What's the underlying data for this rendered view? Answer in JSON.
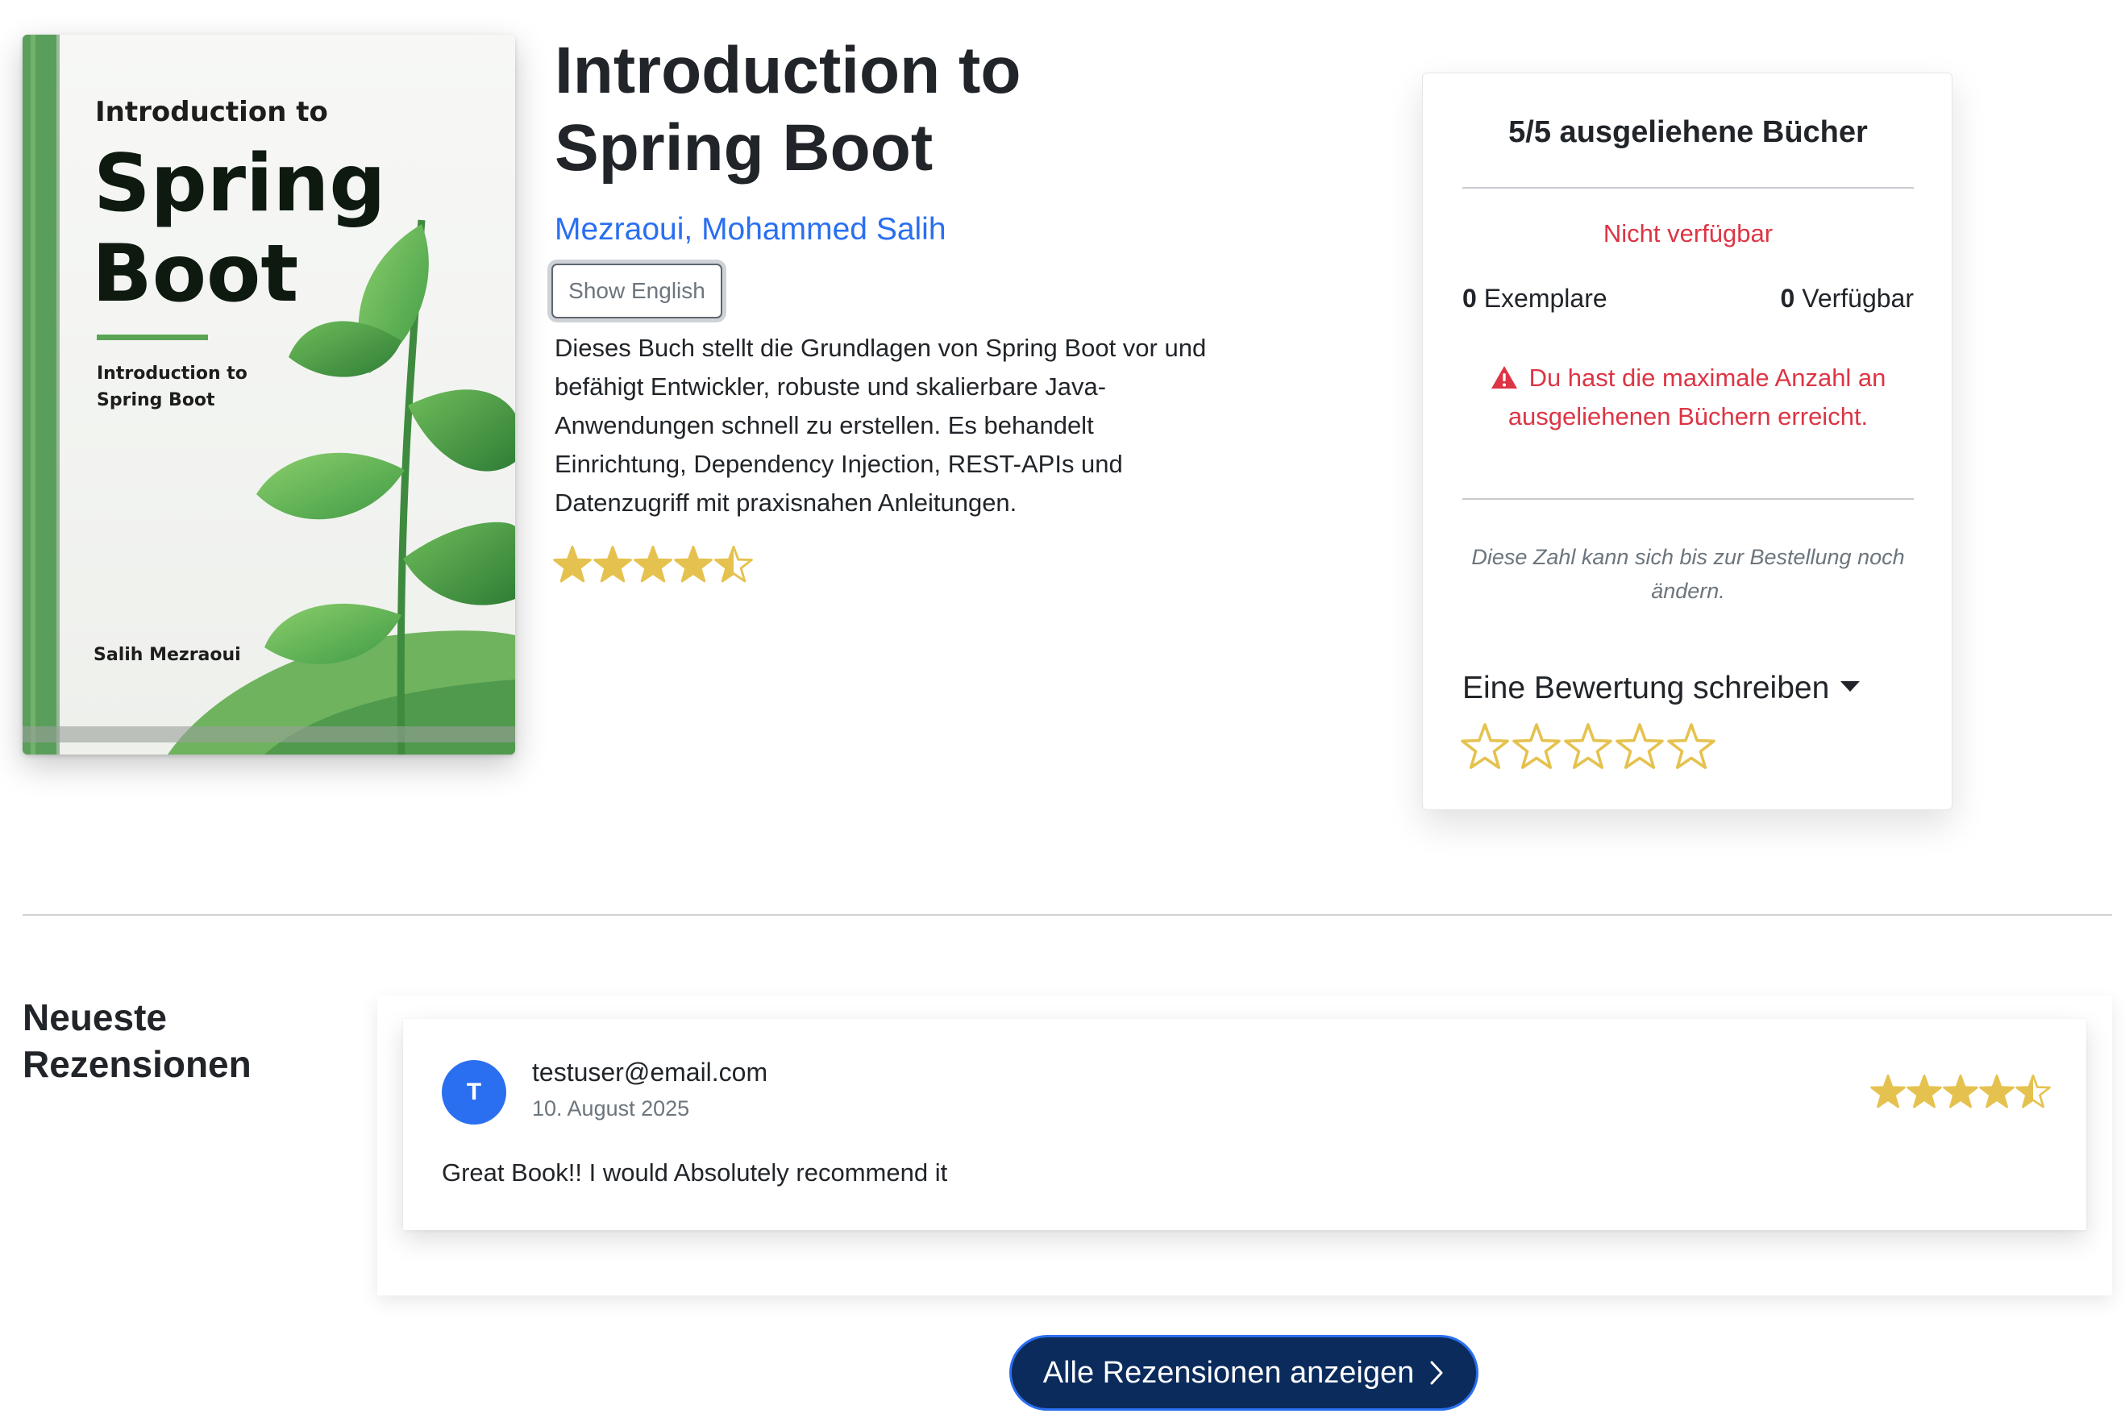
{
  "book": {
    "title": "Introduction to Spring Boot",
    "author": "Mezraoui, Mohammed Salih",
    "language_button": "Show English",
    "description": "Dieses Buch stellt die Grundlagen von Spring Boot vor und befähigt Entwickler, robuste und skalierbare Java-Anwendungen schnell zu erstellen. Es behandelt Einrichtung, Dependency Injection, REST-APIs und Datenzugriff mit praxisnahen Anleitungen.",
    "average_rating": 4.5,
    "rating_max": 5,
    "cover": {
      "title_line_1": "Introduction to",
      "title_line_2": "Spring",
      "title_line_3": "Boot",
      "subtitle_line_1": "Introduction to",
      "subtitle_line_2": "Spring Boot",
      "author": "Salih Mezraoui"
    }
  },
  "availability": {
    "heading": "5/5 ausgeliehene Bücher",
    "status": "Nicht verfügbar",
    "copies_count": "0",
    "copies_label": "Exemplare",
    "available_count": "0",
    "available_label": "Verfügbar",
    "alert_icon": "warning-triangle-icon",
    "alert": "Du hast die maximale Anzahl an ausgeliehenen Büchern erreicht.",
    "note": "Diese Zahl kann sich bis zur Bestellung noch ändern.",
    "review_toggle": "Eine Bewertung schreiben",
    "review_input_stars": 5
  },
  "reviews": {
    "heading": "Neueste Rezensionen",
    "items": [
      {
        "avatar_initial": "T",
        "user": "testuser@email.com",
        "date": "10. August 2025",
        "rating": 4.5,
        "text": "Great Book!! I would Absolutely recommend it"
      }
    ],
    "all_reviews_button": "Alle Rezensionen anzeigen",
    "all_reviews_icon": "chevron-right-icon"
  },
  "colors": {
    "link": "#2a6ff0",
    "danger": "#dc3545",
    "star": "#e5c24f",
    "button_bg": "#0a2b5c",
    "avatar_bg": "#2a6ff0",
    "cover_spine": "#5a9e5c"
  }
}
